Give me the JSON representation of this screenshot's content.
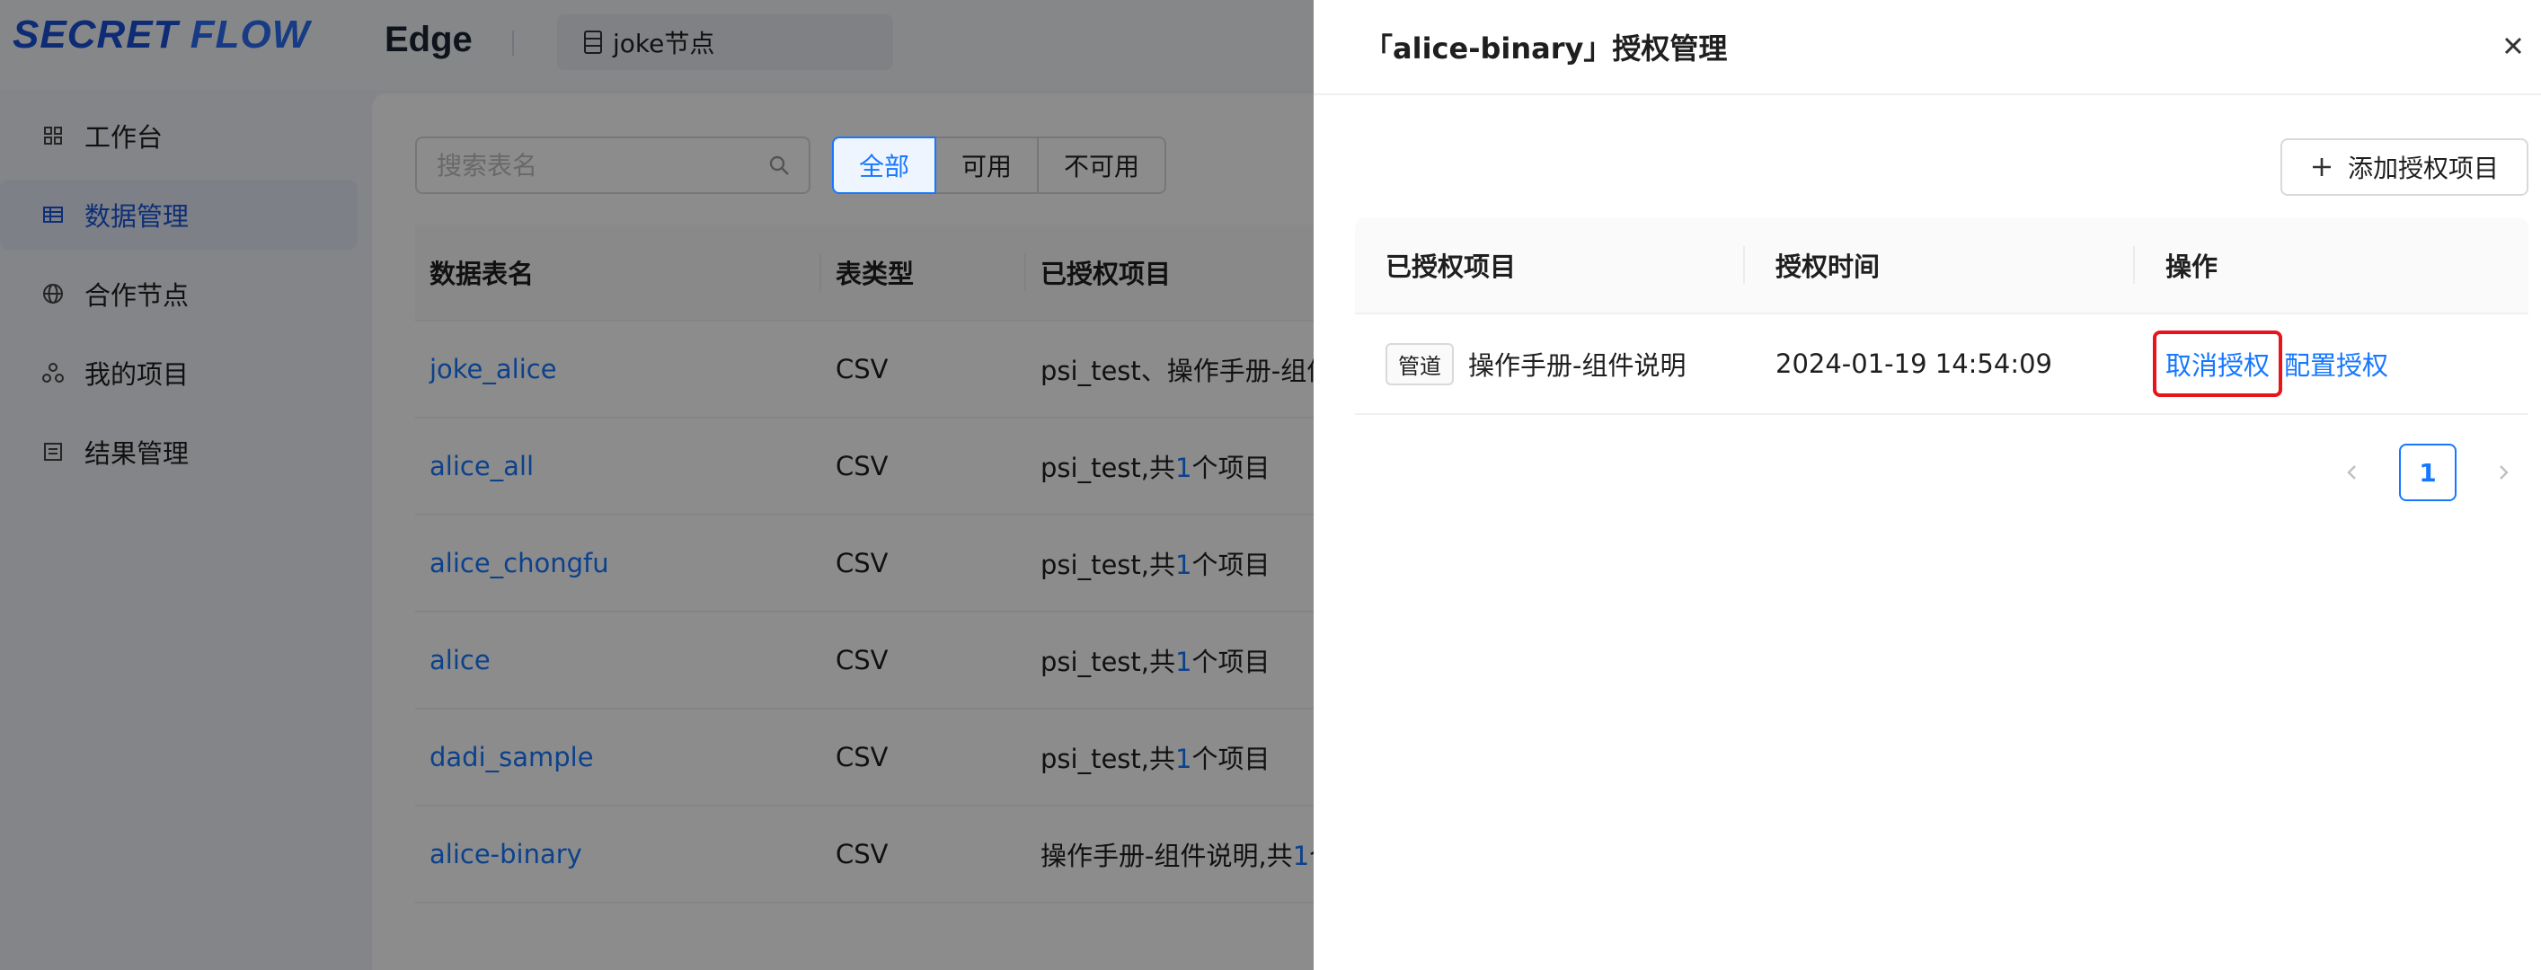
{
  "app": {
    "logo_text_1": "SECRET",
    "logo_text_2": "FLOW",
    "name": "Edge",
    "node_select": "joke节点"
  },
  "sidebar": {
    "items": [
      {
        "label": "工作台",
        "icon": "dashboard-icon"
      },
      {
        "label": "数据管理",
        "icon": "table-icon",
        "active": true
      },
      {
        "label": "合作节点",
        "icon": "globe-icon"
      },
      {
        "label": "我的项目",
        "icon": "project-icon"
      },
      {
        "label": "结果管理",
        "icon": "result-icon"
      }
    ]
  },
  "toolbar": {
    "search_placeholder": "搜索表名",
    "filters": [
      "全部",
      "可用",
      "不可用"
    ],
    "active_filter": "全部"
  },
  "data_table": {
    "headers": [
      "数据表名",
      "表类型",
      "已授权项目"
    ],
    "rows": [
      {
        "name": "joke_alice",
        "type": "CSV",
        "projects_prefix": "psi_test、操作手册-组件",
        "count": "",
        "suffix": ""
      },
      {
        "name": "alice_all",
        "type": "CSV",
        "projects_prefix": "psi_test,共",
        "count": "1",
        "suffix": "个项目"
      },
      {
        "name": "alice_chongfu",
        "type": "CSV",
        "projects_prefix": "psi_test,共",
        "count": "1",
        "suffix": "个项目"
      },
      {
        "name": "alice",
        "type": "CSV",
        "projects_prefix": "psi_test,共",
        "count": "1",
        "suffix": "个项目"
      },
      {
        "name": "dadi_sample",
        "type": "CSV",
        "projects_prefix": "psi_test,共",
        "count": "1",
        "suffix": "个项目"
      },
      {
        "name": "alice-binary",
        "type": "CSV",
        "projects_prefix": "操作手册-组件说明,共",
        "count": "1",
        "suffix": "个"
      }
    ]
  },
  "drawer": {
    "title": "「alice-binary」授权管理",
    "add_button": "添加授权项目",
    "table": {
      "headers": [
        "已授权项目",
        "授权时间",
        "操作"
      ],
      "rows": [
        {
          "tag": "管道",
          "project": "操作手册-组件说明",
          "time": "2024-01-19 14:54:09",
          "cancel": "取消授权",
          "configure": "配置授权"
        }
      ]
    },
    "pagination": {
      "current": "1"
    }
  },
  "colors": {
    "primary": "#1677ff",
    "highlight_border": "#e8141b",
    "mask": "rgba(0,0,0,0.45)"
  }
}
